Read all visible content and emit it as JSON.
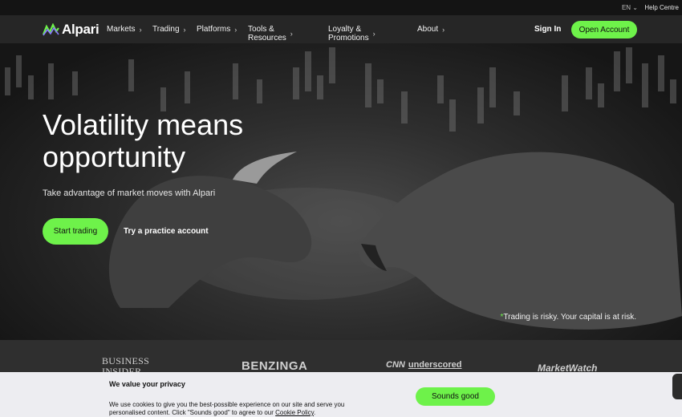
{
  "topbar": {
    "language": "EN",
    "language_chevron": "⌄",
    "help": "Help Centre"
  },
  "nav": {
    "brand": "Alpari",
    "items": [
      {
        "label": "Markets",
        "chevron": "›"
      },
      {
        "label": "Trading",
        "chevron": "›"
      },
      {
        "label": "Platforms",
        "chevron": "›"
      },
      {
        "label": "Tools & Resources",
        "chevron": "›"
      },
      {
        "label": "Loyalty & Promotions",
        "chevron": "›"
      },
      {
        "label": "About",
        "chevron": "›"
      }
    ],
    "sign_in": "Sign In",
    "open_account": "Open Account"
  },
  "hero": {
    "title": "Volatility means opportunity",
    "subtitle": "Take advantage of market moves with Alpari",
    "primary_cta": "Start trading",
    "secondary_cta": "Try a practice account",
    "risk_asterisk": "*",
    "risk_note": "Trading is risky. Your capital is at risk."
  },
  "press": {
    "business_insider": [
      "BUSINESS",
      "INSIDER"
    ],
    "benzinga": "BENZINGA",
    "cnn": "CNN",
    "cnn_underscored": "underscored",
    "marketwatch": "MarketWatch"
  },
  "cookie": {
    "title": "We value your privacy",
    "body": "We use cookies to give you the best-possible experience on our site and serve you personalised content. Click \"Sounds good\" to agree to our",
    "link": "Cookie Policy",
    "end": ".",
    "accept": "Sounds good"
  },
  "colors": {
    "accent": "#6ef24a",
    "nav_bg": "#262626",
    "cookie_bg": "#ededf1"
  }
}
